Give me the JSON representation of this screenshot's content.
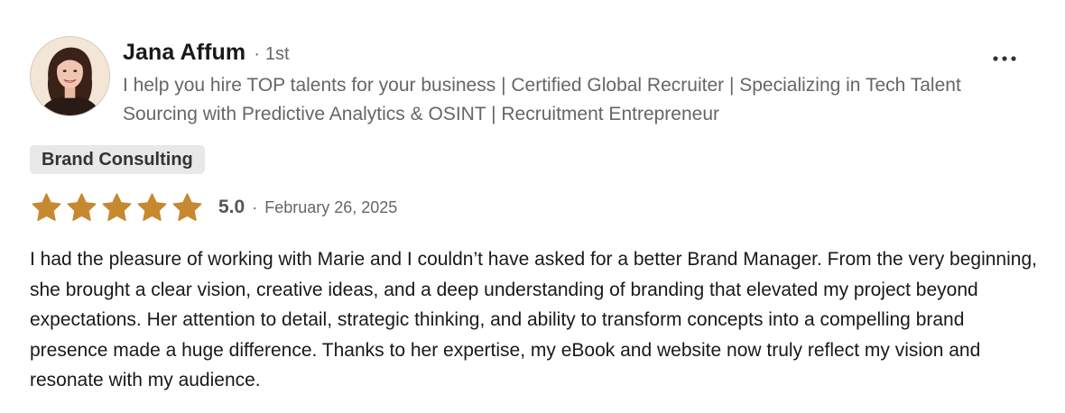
{
  "review": {
    "author": {
      "name": "Jana Affum",
      "separator": "·",
      "connection_degree": "1st",
      "headline": "I help you hire TOP talents for your business | Certified Global Recruiter | Specializing in Tech Talent Sourcing with Predictive Analytics & OSINT | Recruitment Entrepreneur"
    },
    "service_tag": "Brand Consulting",
    "rating": {
      "value": "5.0",
      "stars": 5,
      "max_stars": 5,
      "separator": "·",
      "date": "February 26, 2025"
    },
    "body": "I had the pleasure of working with Marie and I couldn’t have asked for a better Brand Manager. From the very beginning, she brought a clear vision, creative ideas, and a deep understanding of branding that elevated my project beyond expectations. Her attention to detail, strategic thinking, and ability to transform concepts into a compelling brand presence made a huge difference. Thanks to her expertise, my eBook and website now truly reflect my vision and resonate with my audience."
  },
  "icons": {
    "more_menu": "more-horizontal-icon",
    "star": "star-filled-icon"
  },
  "colors": {
    "star_fill": "#c6892f",
    "tag_background": "#e8e8e8",
    "secondary_text": "#666666",
    "primary_text": "#191919"
  }
}
